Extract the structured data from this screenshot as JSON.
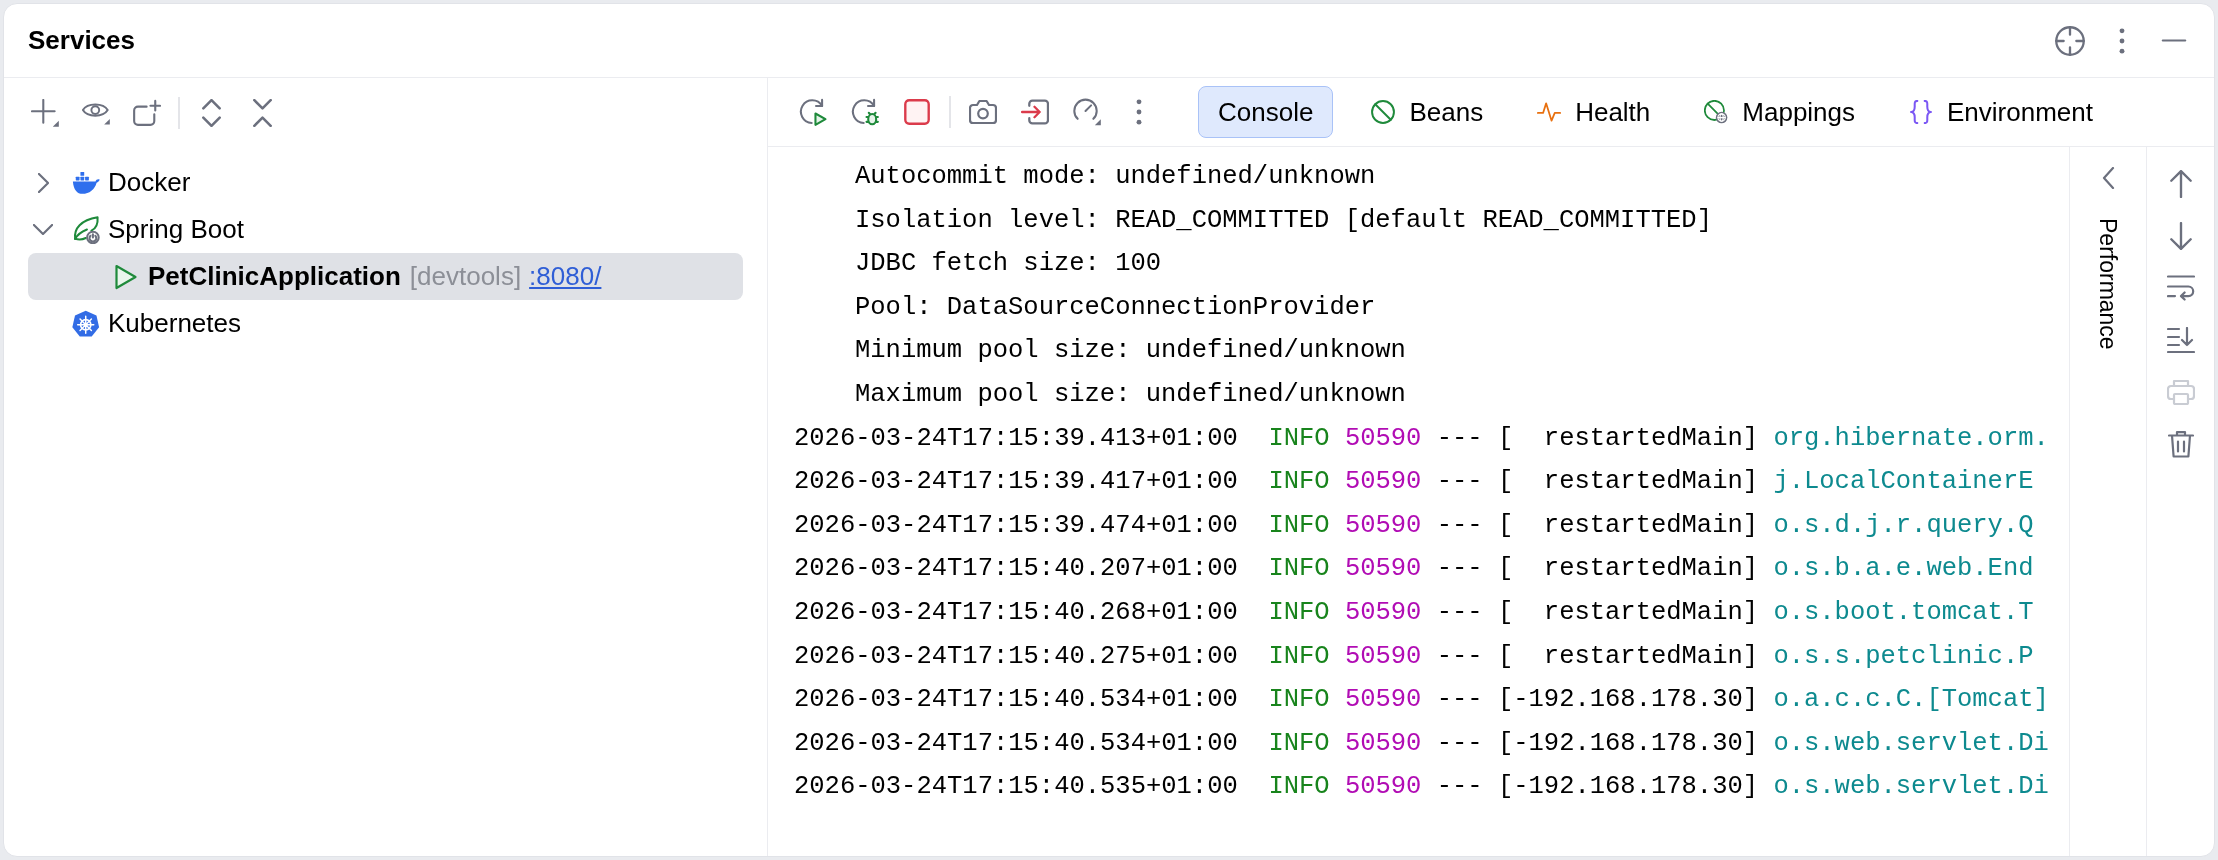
{
  "header": {
    "title": "Services"
  },
  "tree": [
    {
      "kind": "docker",
      "label": "Docker",
      "expanded": false,
      "selected": false
    },
    {
      "kind": "spring-boot",
      "label": "Spring Boot",
      "expanded": true,
      "selected": false,
      "children": [
        {
          "kind": "run-config",
          "label": "PetClinicApplication",
          "tag": "[devtools]",
          "link": ":8080/",
          "selected": true
        }
      ]
    },
    {
      "kind": "kubernetes",
      "label": "Kubernetes",
      "selected": false
    }
  ],
  "tabs": [
    {
      "label": "Console",
      "selected": true
    },
    {
      "label": "Beans",
      "selected": false
    },
    {
      "label": "Health",
      "selected": false
    },
    {
      "label": "Mappings",
      "selected": false
    },
    {
      "label": "Environment",
      "selected": false
    }
  ],
  "console": {
    "lines": [
      {
        "kind": "detail",
        "text": "Autocommit mode: undefined/unknown"
      },
      {
        "kind": "detail",
        "text": "Isolation level: READ_COMMITTED [default READ_COMMITTED]"
      },
      {
        "kind": "detail",
        "text": "JDBC fetch size: 100"
      },
      {
        "kind": "detail",
        "text": "Pool: DataSourceConnectionProvider"
      },
      {
        "kind": "detail",
        "text": "Minimum pool size: undefined/unknown"
      },
      {
        "kind": "detail",
        "text": "Maximum pool size: undefined/unknown"
      },
      {
        "kind": "log",
        "timestamp": "2026-03-24T17:15:39.413+01:00",
        "level": "INFO",
        "pid": "50590",
        "separator": "---",
        "thread": "[  restartedMain]",
        "logger": "org.hibernate.orm."
      },
      {
        "kind": "log",
        "timestamp": "2026-03-24T17:15:39.417+01:00",
        "level": "INFO",
        "pid": "50590",
        "separator": "---",
        "thread": "[  restartedMain]",
        "logger": "j.LocalContainerE"
      },
      {
        "kind": "log",
        "timestamp": "2026-03-24T17:15:39.474+01:00",
        "level": "INFO",
        "pid": "50590",
        "separator": "---",
        "thread": "[  restartedMain]",
        "logger": "o.s.d.j.r.query.Q"
      },
      {
        "kind": "log",
        "timestamp": "2026-03-24T17:15:40.207+01:00",
        "level": "INFO",
        "pid": "50590",
        "separator": "---",
        "thread": "[  restartedMain]",
        "logger": "o.s.b.a.e.web.End"
      },
      {
        "kind": "log",
        "timestamp": "2026-03-24T17:15:40.268+01:00",
        "level": "INFO",
        "pid": "50590",
        "separator": "---",
        "thread": "[  restartedMain]",
        "logger": "o.s.boot.tomcat.T"
      },
      {
        "kind": "log",
        "timestamp": "2026-03-24T17:15:40.275+01:00",
        "level": "INFO",
        "pid": "50590",
        "separator": "---",
        "thread": "[  restartedMain]",
        "logger": "o.s.s.petclinic.P"
      },
      {
        "kind": "log",
        "timestamp": "2026-03-24T17:15:40.534+01:00",
        "level": "INFO",
        "pid": "50590",
        "separator": "---",
        "thread": "[-192.168.178.30]",
        "logger": "o.a.c.c.C.[Tomcat]"
      },
      {
        "kind": "log",
        "timestamp": "2026-03-24T17:15:40.534+01:00",
        "level": "INFO",
        "pid": "50590",
        "separator": "---",
        "thread": "[-192.168.178.30]",
        "logger": "o.s.web.servlet.Di"
      },
      {
        "kind": "log",
        "timestamp": "2026-03-24T17:15:40.535+01:00",
        "level": "INFO",
        "pid": "50590",
        "separator": "---",
        "thread": "[-192.168.178.30]",
        "logger": "o.s.web.servlet.Di"
      }
    ]
  },
  "side_panel": {
    "label": "Performance",
    "expanded": false
  },
  "console_actions": [
    {
      "kind": "up",
      "disabled": false
    },
    {
      "kind": "down",
      "disabled": false
    },
    {
      "kind": "soft-wrap",
      "disabled": false
    },
    {
      "kind": "scroll-to-end",
      "disabled": false
    },
    {
      "kind": "print",
      "disabled": true
    },
    {
      "kind": "clear",
      "disabled": false
    }
  ]
}
